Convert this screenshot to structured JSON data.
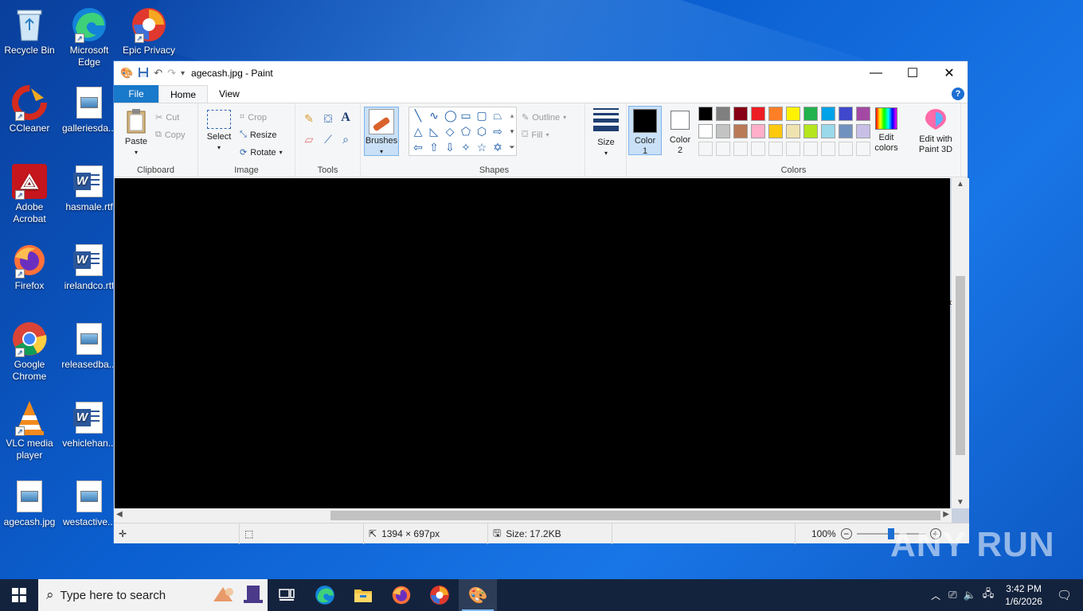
{
  "desktop": {
    "icons": [
      {
        "label": "Recycle Bin"
      },
      {
        "label": "Microsoft Edge"
      },
      {
        "label": "Epic Privacy"
      },
      {
        "label": "CCleaner"
      },
      {
        "label": "galleriesda..."
      },
      {
        "label": "Adobe Acrobat"
      },
      {
        "label": "hasmale.rtf"
      },
      {
        "label": "Firefox"
      },
      {
        "label": "irelandco.rtf"
      },
      {
        "label": "Google Chrome"
      },
      {
        "label": "releasedba..."
      },
      {
        "label": "VLC media player"
      },
      {
        "label": "vehiclehan..."
      },
      {
        "label": "agecash.jpg"
      },
      {
        "label": "westactive..."
      }
    ]
  },
  "paint": {
    "title": "agecash.jpg - Paint",
    "tabs": {
      "file": "File",
      "home": "Home",
      "view": "View"
    },
    "help": "?",
    "clipboard": {
      "label": "Clipboard",
      "paste": "Paste",
      "cut": "Cut",
      "copy": "Copy"
    },
    "image": {
      "label": "Image",
      "select": "Select",
      "crop": "Crop",
      "resize": "Resize",
      "rotate": "Rotate"
    },
    "tools": {
      "label": "Tools",
      "text_glyph": "A"
    },
    "brushes": "Brushes",
    "shapes": {
      "label": "Shapes",
      "outline": "Outline",
      "fill": "Fill"
    },
    "size": "Size",
    "color1": {
      "label_a": "Color",
      "label_b": "1",
      "value": "#000000"
    },
    "color2": {
      "label_a": "Color",
      "label_b": "2",
      "value": "#ffffff"
    },
    "colors": {
      "label": "Colors",
      "row1": [
        "#000000",
        "#7f7f7f",
        "#880015",
        "#ed1c24",
        "#ff7f27",
        "#fff200",
        "#22b14c",
        "#00a2e8",
        "#3f48cc",
        "#a349a4"
      ],
      "row2": [
        "#ffffff",
        "#c3c3c3",
        "#b97a57",
        "#ffaec9",
        "#ffc90e",
        "#efe4b0",
        "#b5e61d",
        "#99d9ea",
        "#7092be",
        "#c8bfe7"
      ]
    },
    "edit_colors": {
      "a": "Edit",
      "b": "colors"
    },
    "paint3d": {
      "a": "Edit with",
      "b": "Paint 3D"
    },
    "status": {
      "dimensions": "1394 × 697px",
      "size": "Size: 17.2KB",
      "zoom": "100%",
      "zoom_level": 0.5
    }
  },
  "taskbar": {
    "search_placeholder": "Type here to search",
    "time": "3:42 PM",
    "date": "1/6/2026"
  },
  "watermark": "ANY RUN"
}
